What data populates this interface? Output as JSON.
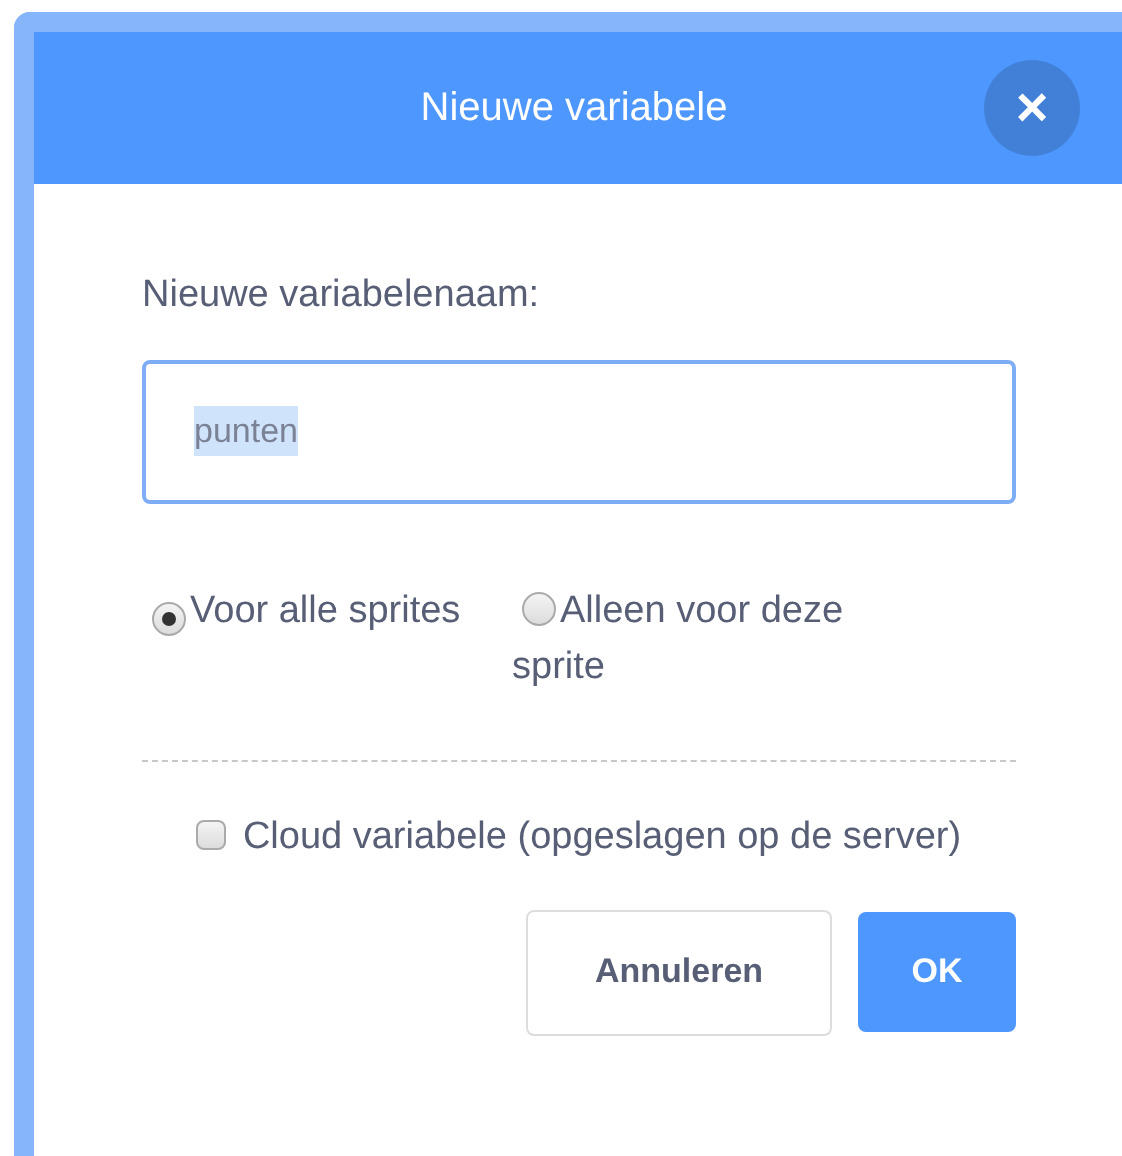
{
  "dialog": {
    "title": "Nieuwe variabele",
    "close": "×"
  },
  "name_field": {
    "label": "Nieuwe variabelenaam:",
    "value": "punten",
    "text_selected": true
  },
  "scope_options": [
    {
      "label": "Voor alle sprites",
      "selected": true
    },
    {
      "label": "Alleen voor deze sprite",
      "selected": false
    }
  ],
  "cloud_option": {
    "label": "Cloud variabele (opgeslagen op de server)",
    "checked": false
  },
  "buttons": [
    {
      "label": "Annuleren",
      "kind": "secondary"
    },
    {
      "label": "OK",
      "kind": "primary"
    }
  ]
}
